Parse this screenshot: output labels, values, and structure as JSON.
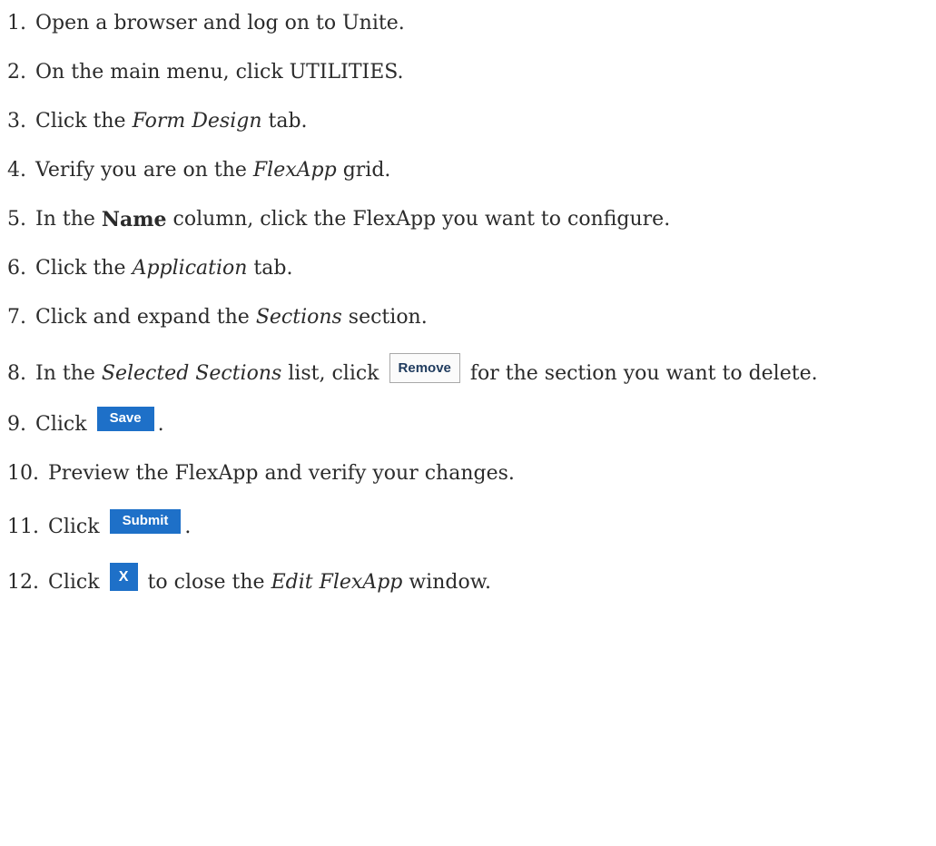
{
  "steps": [
    {
      "num": "1.",
      "text": "Open a browser and log on to Unite."
    },
    {
      "num": "2.",
      "text": "On the main menu, click UTILITIES."
    },
    {
      "num": "3.",
      "pre": "Click the ",
      "em": "Form Design",
      "post": " tab."
    },
    {
      "num": "4.",
      "pre": "Verify you are on the ",
      "em": "FlexApp",
      "post": " grid."
    },
    {
      "num": "5.",
      "pre": "In the ",
      "bold": "Name",
      "post": " column, click the FlexApp you want to configure."
    },
    {
      "num": "6.",
      "pre": "Click the ",
      "em": "Application",
      "post": " tab."
    },
    {
      "num": "7.",
      "pre": "Click and expand the ",
      "em": "Sections",
      "post": " section."
    },
    {
      "num": "8.",
      "pre": "In the ",
      "em": "Selected Sections",
      "mid": " list, click ",
      "button": "Remove",
      "post": " for the section you want to delete."
    },
    {
      "num": "9.",
      "pre": "Click ",
      "button": "Save",
      "post": "."
    },
    {
      "num": "10.",
      "text": "Preview the FlexApp and verify your changes."
    },
    {
      "num": "11.",
      "pre": "Click ",
      "button": "Submit",
      "post": "."
    },
    {
      "num": "12.",
      "pre": "Click ",
      "button": "X",
      "mid": " to close the ",
      "em": "Edit FlexApp",
      "post": " window."
    }
  ],
  "colors": {
    "text": "#2b2b2b",
    "button_blue": "#1e70c8",
    "button_gray_border": "#a9a9a9"
  }
}
